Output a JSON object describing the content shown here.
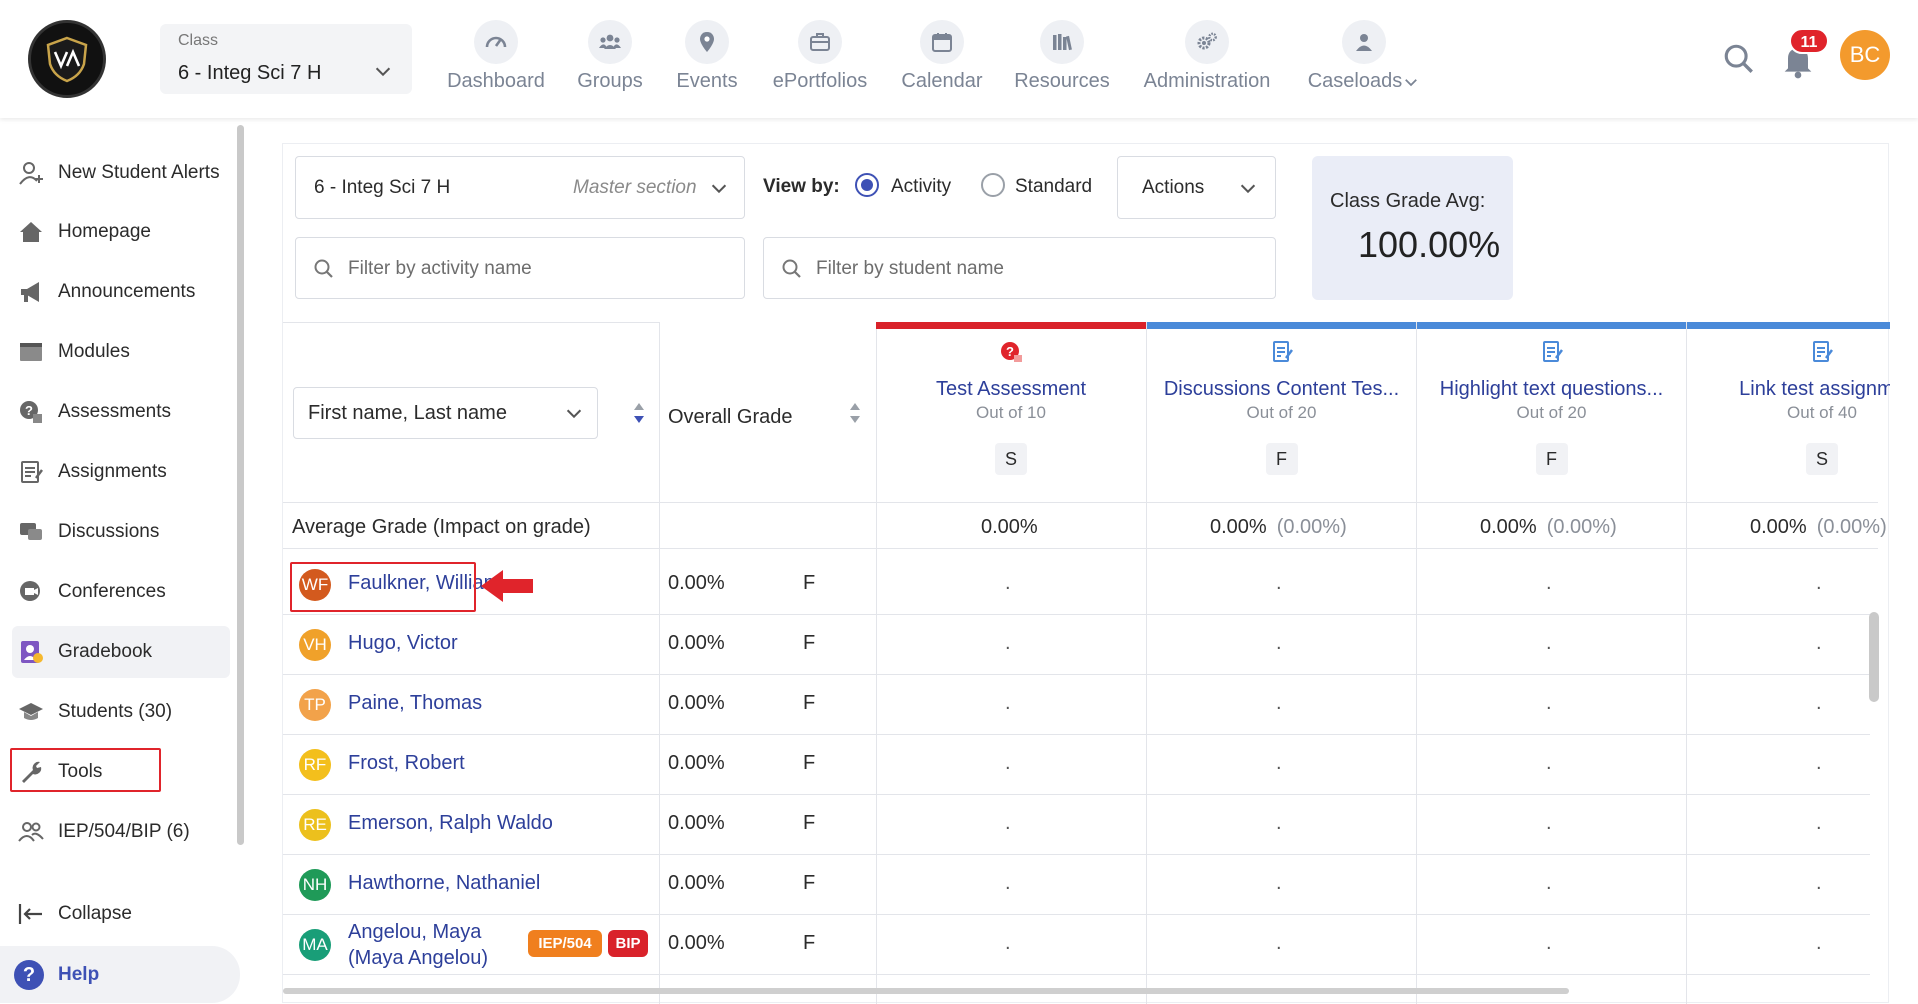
{
  "header": {
    "class_label": "Class",
    "class_value": "6 - Integ Sci 7 H",
    "nav": [
      {
        "label": "Dashboard",
        "icon": "speedometer-icon"
      },
      {
        "label": "Groups",
        "icon": "groups-icon"
      },
      {
        "label": "Events",
        "icon": "map-pin-icon"
      },
      {
        "label": "ePortfolios",
        "icon": "briefcase-icon"
      },
      {
        "label": "Calendar",
        "icon": "calendar-icon"
      },
      {
        "label": "Resources",
        "icon": "books-icon"
      },
      {
        "label": "Administration",
        "icon": "gears-icon"
      },
      {
        "label": "Caseloads",
        "icon": "person-icon"
      }
    ],
    "notifications_count": "11",
    "user_initials": "BC"
  },
  "sidebar": {
    "items": [
      {
        "label": "New Student Alerts",
        "icon": "person-add-icon"
      },
      {
        "label": "Homepage",
        "icon": "home-icon"
      },
      {
        "label": "Announcements",
        "icon": "megaphone-icon"
      },
      {
        "label": "Modules",
        "icon": "folder-icon"
      },
      {
        "label": "Assessments",
        "icon": "assessment-icon"
      },
      {
        "label": "Assignments",
        "icon": "clipboard-icon"
      },
      {
        "label": "Discussions",
        "icon": "chat-bubbles-icon"
      },
      {
        "label": "Conferences",
        "icon": "video-chat-icon"
      },
      {
        "label": "Gradebook",
        "icon": "gradebook-icon"
      },
      {
        "label": "Students (30)",
        "icon": "graduation-cap-icon"
      },
      {
        "label": "Tools",
        "icon": "wrench-icon"
      },
      {
        "label": "IEP/504/BIP (6)",
        "icon": "people-icon"
      }
    ],
    "collapse_label": "Collapse",
    "help_label": "Help"
  },
  "toolbar": {
    "section_value": "6 - Integ Sci 7 H",
    "section_meta": "Master section",
    "view_by_label": "View by:",
    "view_options": [
      "Activity",
      "Standard"
    ],
    "selected_view": "Activity",
    "actions_label": "Actions",
    "filter_activity_placeholder": "Filter by activity name",
    "filter_student_placeholder": "Filter by student name",
    "class_avg_label": "Class Grade Avg:",
    "class_avg_value": "100.00%"
  },
  "grid": {
    "name_sort_value": "First name, Last name",
    "overall_grade_label": "Overall Grade",
    "average_row_label": "Average Grade (Impact on grade)",
    "columns": [
      {
        "title": "Test Assessment",
        "out_of": "Out of 10",
        "tag": "S",
        "bar_color": "#d9222a",
        "icon": "test-alert-icon",
        "avg": "0.00%",
        "impact": ""
      },
      {
        "title": "Discussions Content Tes...",
        "out_of": "Out of 20",
        "tag": "F",
        "bar_color": "#4a8ad9",
        "icon": "assignment-doc-icon",
        "avg": "0.00%",
        "impact": "(0.00%)"
      },
      {
        "title": "Highlight text questions...",
        "out_of": "Out of 20",
        "tag": "F",
        "bar_color": "#4a8ad9",
        "icon": "assignment-doc-icon",
        "avg": "0.00%",
        "impact": "(0.00%)"
      },
      {
        "title": "Link test assignme",
        "out_of": "Out of 40",
        "tag": "S",
        "bar_color": "#4a8ad9",
        "icon": "assignment-doc-icon",
        "avg": "0.00%",
        "impact": "(0.00%)"
      }
    ],
    "students": [
      {
        "initials": "WF",
        "name": "Faulkner, William",
        "name2": "",
        "overall": "0.00%",
        "letter": "F",
        "color": "#d35a1e",
        "badges": [],
        "cells": [
          ".",
          ".",
          ".",
          "."
        ]
      },
      {
        "initials": "VH",
        "name": "Hugo, Victor",
        "name2": "",
        "overall": "0.00%",
        "letter": "F",
        "color": "#f0a12a",
        "badges": [],
        "cells": [
          ".",
          ".",
          ".",
          "."
        ]
      },
      {
        "initials": "TP",
        "name": "Paine, Thomas",
        "name2": "",
        "overall": "0.00%",
        "letter": "F",
        "color": "#f2a24a",
        "badges": [],
        "cells": [
          ".",
          ".",
          ".",
          "."
        ]
      },
      {
        "initials": "RF",
        "name": "Frost, Robert",
        "name2": "",
        "overall": "0.00%",
        "letter": "F",
        "color": "#f3bf1c",
        "badges": [],
        "cells": [
          ".",
          ".",
          ".",
          "."
        ]
      },
      {
        "initials": "RE",
        "name": "Emerson, Ralph Waldo",
        "name2": "",
        "overall": "0.00%",
        "letter": "F",
        "color": "#ecc01d",
        "badges": [],
        "cells": [
          ".",
          ".",
          ".",
          "."
        ]
      },
      {
        "initials": "NH",
        "name": "Hawthorne, Nathaniel",
        "name2": "",
        "overall": "0.00%",
        "letter": "F",
        "color": "#1f9a58",
        "badges": [],
        "cells": [
          ".",
          ".",
          ".",
          "."
        ]
      },
      {
        "initials": "MA",
        "name": "Angelou, Maya",
        "name2": "(Maya Angelou)",
        "overall": "0.00%",
        "letter": "F",
        "color": "#199e78",
        "badges": [
          {
            "label": "IEP/504",
            "color": "#f07f1e"
          },
          {
            "label": "BIP",
            "color": "#d9222a"
          }
        ],
        "cells": [
          ".",
          ".",
          ".",
          "."
        ]
      }
    ]
  }
}
